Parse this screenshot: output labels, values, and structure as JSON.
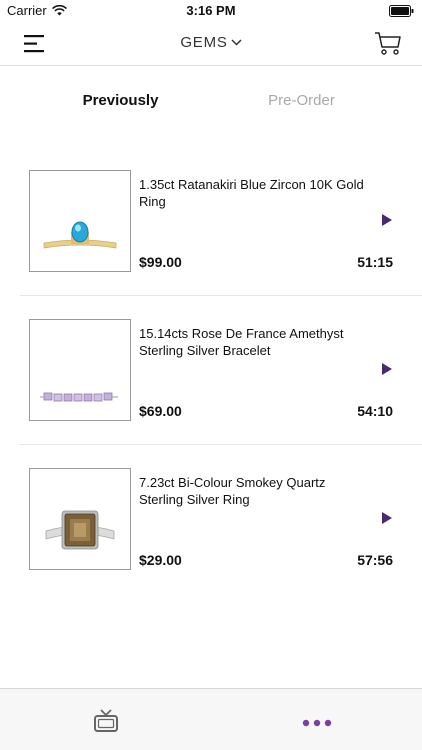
{
  "status_bar": {
    "carrier": "Carrier",
    "time": "3:16 PM"
  },
  "nav": {
    "title": "GEMS",
    "menu_icon": "hamburger-menu-icon",
    "cart_icon": "shopping-cart-icon"
  },
  "tabs": [
    {
      "label": "Previously",
      "active": true
    },
    {
      "label": "Pre-Order",
      "active": false
    }
  ],
  "products": [
    {
      "title": "1.35ct Ratanakiri Blue Zircon 10K Gold Ring",
      "price": "$99.00",
      "timer": "51:15"
    },
    {
      "title": "15.14cts Rose De France Amethyst Sterling Silver Bracelet",
      "price": "$69.00",
      "timer": "54:10"
    },
    {
      "title": "7.23ct Bi-Colour Smokey Quartz Sterling Silver Ring",
      "price": "$29.00",
      "timer": "57:56"
    }
  ],
  "tab_bar": {
    "tv_icon": "tv-icon",
    "more_icon": "more-dots-icon"
  },
  "colors": {
    "accent": "#4a2a6e",
    "more_dots": "#7b3fa0",
    "inactive_tab": "#a9a9a9"
  }
}
